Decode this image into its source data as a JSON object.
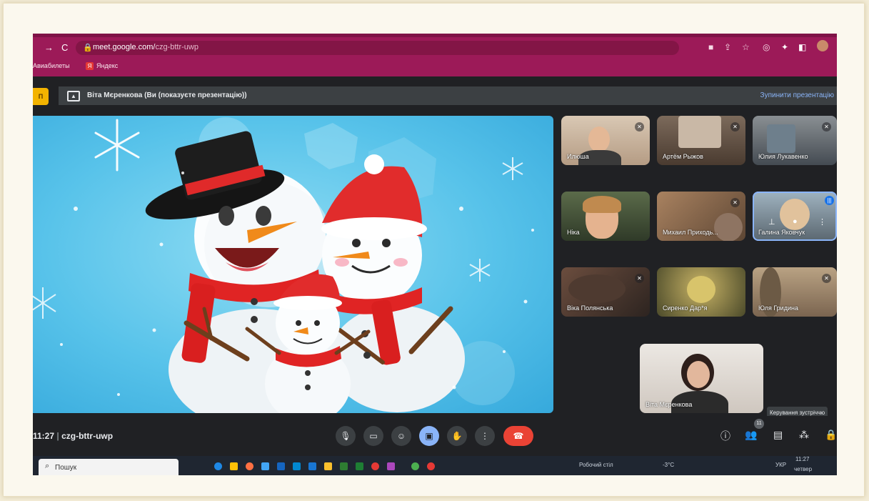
{
  "browser": {
    "url_host": "meet.google.com/",
    "url_path": "czg-bttr-uwp",
    "bookmarks": [
      "Авиабилеты",
      "Яндекс"
    ]
  },
  "meet": {
    "presenting_text": "Віта Мєренкова (Ви (показуєте презентацію))",
    "stop_presenting": "Зупинити презентацію",
    "time": "11:27",
    "meeting_code": "czg-bttr-uwp",
    "people_count": "11",
    "tooltip": "Керування зустріччю",
    "logo_text": "П"
  },
  "participants": [
    {
      "name": "Илюша",
      "muted": true
    },
    {
      "name": "Артём Рыжов",
      "muted": true
    },
    {
      "name": "Юлия Лукавенко",
      "muted": true
    },
    {
      "name": "Ніка",
      "muted": false
    },
    {
      "name": "Михаил Приходь...",
      "muted": true
    },
    {
      "name": "Галина Яковчук",
      "muted": false
    },
    {
      "name": "Віка Полянська",
      "muted": true
    },
    {
      "name": "Сиренко Дар*я",
      "muted": false
    },
    {
      "name": "Юля Гридина",
      "muted": true
    }
  ],
  "self_tile": {
    "name": "Віта Мєренкова"
  },
  "taskbar": {
    "search_placeholder": "Пошук",
    "desktop_label": "Робочий стіл",
    "temperature": "-3°C",
    "lang": "УКР",
    "time": "11:27",
    "day": "четвер"
  },
  "colors": {
    "browser_accent": "#9c1a58",
    "meet_bg": "#202124",
    "end_call": "#ea4335",
    "present_active": "#8ab4f8"
  },
  "icons": [
    "back-arrow",
    "forward-arrow",
    "reload",
    "lock",
    "camera",
    "share",
    "star",
    "extension",
    "sidepanel",
    "profile",
    "present",
    "microphone",
    "video",
    "emoji",
    "raise-hand",
    "more",
    "end-call",
    "info",
    "people",
    "chat",
    "activities",
    "lock-meeting"
  ]
}
